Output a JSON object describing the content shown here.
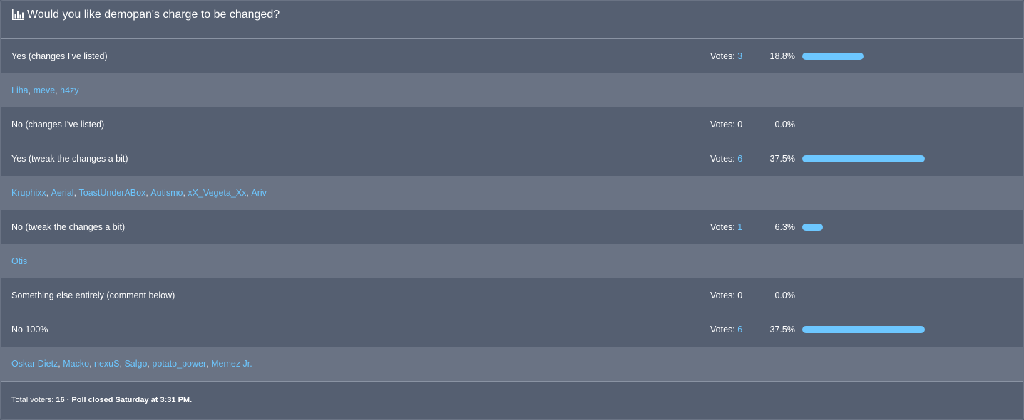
{
  "poll": {
    "title": "Would you like demopan's charge to be changed?",
    "icon": "bar-chart-icon",
    "accent_color": "#6dc7ff",
    "options": [
      {
        "label": "Yes (changes I've listed)",
        "votes_label": "Votes:",
        "votes": "3",
        "percent": "18.8%",
        "fraction": 0.188,
        "voters": [
          "Liha",
          "meve",
          "h4zy"
        ]
      },
      {
        "label": "No (changes I've listed)",
        "votes_label": "Votes:",
        "votes": "0",
        "percent": "0.0%",
        "fraction": 0.0,
        "voters": []
      },
      {
        "label": "Yes (tweak the changes a bit)",
        "votes_label": "Votes:",
        "votes": "6",
        "percent": "37.5%",
        "fraction": 0.375,
        "voters": [
          "Kruphixx",
          "Aerial",
          "ToastUnderABox",
          "Autismo",
          "xX_Vegeta_Xx",
          "Ariv"
        ]
      },
      {
        "label": "No (tweak the changes a bit)",
        "votes_label": "Votes:",
        "votes": "1",
        "percent": "6.3%",
        "fraction": 0.063,
        "voters": [
          "Otis"
        ]
      },
      {
        "label": "Something else entirely (comment below)",
        "votes_label": "Votes:",
        "votes": "0",
        "percent": "0.0%",
        "fraction": 0.0,
        "voters": []
      },
      {
        "label": "No 100%",
        "votes_label": "Votes:",
        "votes": "6",
        "percent": "37.5%",
        "fraction": 0.375,
        "voters": [
          "Oskar Dietz",
          "Macko",
          "nexuS",
          "Salgo",
          "potato_power",
          "Memez Jr."
        ]
      }
    ],
    "footer": {
      "total_label": "Total voters:",
      "total": "16",
      "separator": "·",
      "closed_text": "Poll closed Saturday at 3:31 PM."
    }
  }
}
